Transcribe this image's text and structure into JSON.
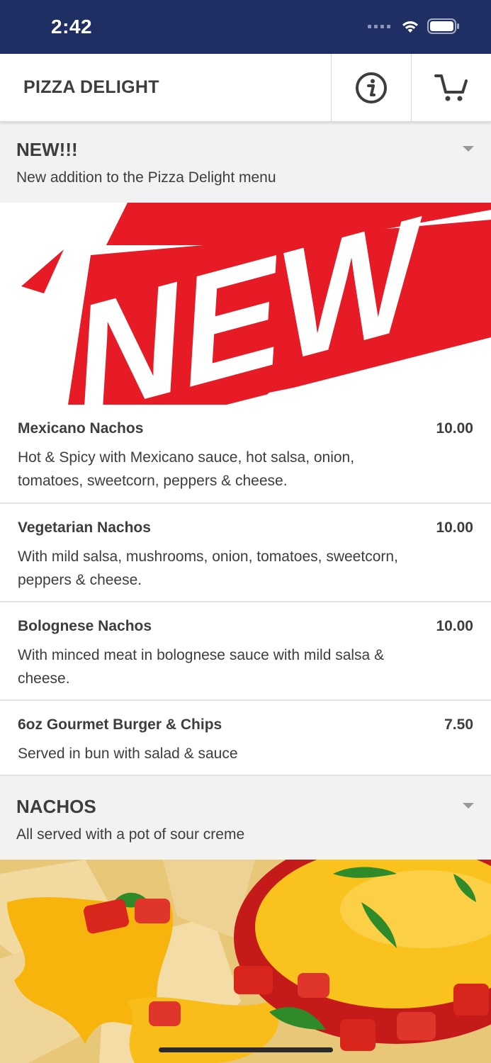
{
  "status_bar": {
    "time": "2:42"
  },
  "header": {
    "title": "PIZZA DELIGHT"
  },
  "sections": [
    {
      "title": "NEW!!!",
      "description": "New addition to the Pizza Delight menu",
      "banner_text": "NEW"
    },
    {
      "title": "NACHOS",
      "description": "All served with a pot of sour creme"
    }
  ],
  "items": [
    {
      "name": "Mexicano Nachos",
      "price": "10.00",
      "description": "Hot & Spicy with Mexicano sauce, hot salsa, onion, tomatoes, sweetcorn, peppers & cheese."
    },
    {
      "name": "Vegetarian Nachos",
      "price": "10.00",
      "description": "With mild salsa, mushrooms, onion, tomatoes, sweetcorn, peppers & cheese."
    },
    {
      "name": "Bolognese Nachos",
      "price": "10.00",
      "description": "With minced meat in bolognese sauce with mild salsa & cheese."
    },
    {
      "name": "6oz Gourmet Burger & Chips",
      "price": "7.50",
      "description": "Served in bun with salad & sauce"
    }
  ],
  "colors": {
    "status_bar": "#1f2f63",
    "banner_red": "#e61b25",
    "section_bg": "#f2f2f2",
    "cheese": "#f6b40c"
  },
  "icons": {
    "info": "info-circle-icon",
    "cart": "shopping-cart-icon",
    "wifi": "wifi-icon",
    "battery": "battery-icon",
    "caret": "caret-down-icon"
  }
}
